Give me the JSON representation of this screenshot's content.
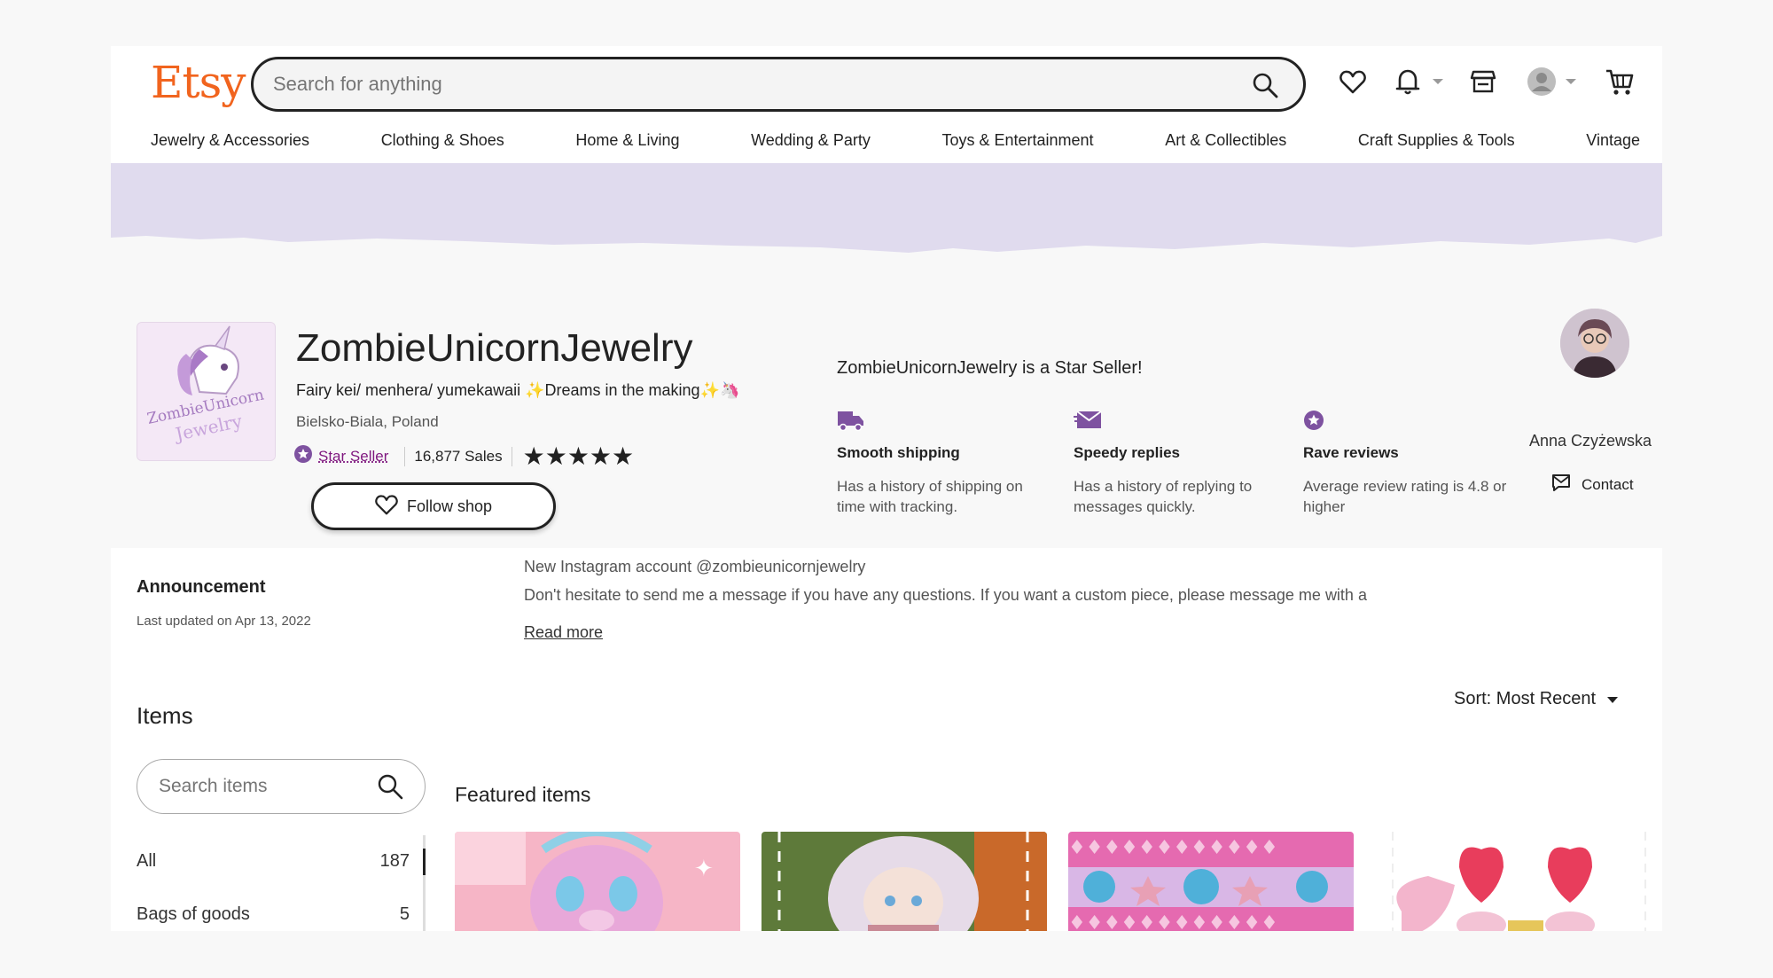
{
  "header": {
    "logo": "Etsy",
    "search_placeholder": "Search for anything"
  },
  "categories": [
    "Jewelry & Accessories",
    "Clothing & Shoes",
    "Home & Living",
    "Wedding & Party",
    "Toys & Entertainment",
    "Art & Collectibles",
    "Craft Supplies & Tools",
    "Vintage"
  ],
  "shop": {
    "name": "ZombieUnicornJewelry",
    "tagline": "Fairy kei/ menhera/ yumekawaii ✨Dreams in the making✨🦄",
    "location": "Bielsko-Biala, Poland",
    "star_seller_label": "Star Seller",
    "sales": "16,877 Sales",
    "rating": 5,
    "stars": "★★★★★",
    "follow_label": "Follow shop",
    "star_seller_title": "ZombieUnicornJewelry is a Star Seller!"
  },
  "features": [
    {
      "title": "Smooth shipping",
      "desc": "Has a history of shipping on time with tracking.",
      "icon": "truck-icon"
    },
    {
      "title": "Speedy replies",
      "desc": "Has a history of replying to messages quickly.",
      "icon": "envelope-icon"
    },
    {
      "title": "Rave reviews",
      "desc": "Average review rating is 4.8 or higher",
      "icon": "star-badge-icon"
    }
  ],
  "owner": {
    "name": "Anna Czyżewska",
    "contact_label": "Contact"
  },
  "announcement": {
    "heading": "Announcement",
    "updated": "Last updated on Apr 13, 2022",
    "line1": "New Instagram account @zombieunicornjewelry",
    "line2": "Don't hesitate to send me a message if you have any questions. If you want a custom piece, please message me with a",
    "read_more": "Read more"
  },
  "items": {
    "heading": "Items",
    "sort_label": "Sort: Most Recent",
    "search_placeholder": "Search items",
    "sections": [
      {
        "name": "All",
        "count": "187"
      },
      {
        "name": "Bags of goods",
        "count": "5"
      }
    ],
    "featured_heading": "Featured items"
  },
  "colors": {
    "brand": "#f1641e",
    "star_seller": "#7f187f",
    "banner": "#e0dbee",
    "feature_icon": "#7e52a0"
  }
}
